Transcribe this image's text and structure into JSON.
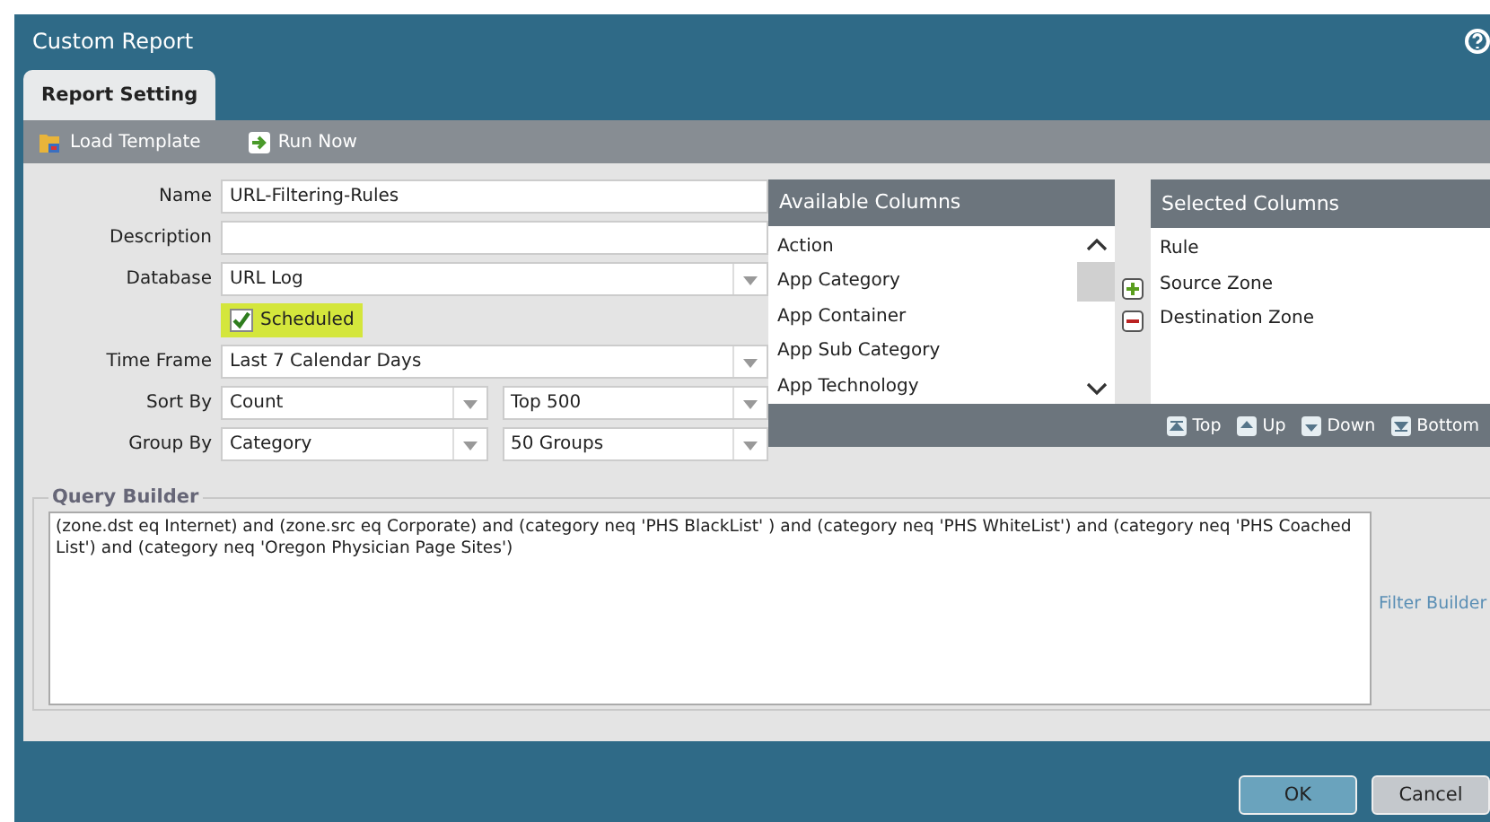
{
  "window": {
    "title": "Custom Report"
  },
  "tabs": [
    {
      "label": "Report Setting",
      "selected": true
    }
  ],
  "toolbar": [
    {
      "label": "Load Template",
      "kind": "folder"
    },
    {
      "label": "Run Now",
      "kind": "run"
    }
  ],
  "form": {
    "name": {
      "label": "Name",
      "value": "URL-Filtering-Rules"
    },
    "description": {
      "label": "Description"
    },
    "database": {
      "label": "Database",
      "value": "URL Log"
    },
    "scheduled": {
      "label": "Scheduled",
      "checked": true
    },
    "time_frame": {
      "label": "Time Frame",
      "value": "Last 7 Calendar Days"
    },
    "sort_by": {
      "label": "Sort By",
      "value": "Count",
      "limit": "Top 500"
    },
    "group_by": {
      "label": "Group By",
      "value": "Category",
      "limit": "50 Groups"
    }
  },
  "available_columns": {
    "title": "Available Columns",
    "items": [
      "Action",
      "App Category",
      "App Container",
      "App Sub Category",
      "App Technology"
    ]
  },
  "selected_columns": {
    "title": "Selected Columns",
    "items": [
      "Rule",
      "Source Zone",
      "Destination Zone"
    ]
  },
  "order_buttons": [
    {
      "label": "Top",
      "kind": "top"
    },
    {
      "label": "Up",
      "kind": "up"
    },
    {
      "label": "Down",
      "kind": "down"
    },
    {
      "label": "Bottom",
      "kind": "bottom"
    }
  ],
  "query_builder": {
    "title": "Query Builder",
    "value": "(zone.dst eq Internet) and (zone.src eq Corporate) and (category neq 'PHS BlackList' ) and (category neq 'PHS WhiteList') and (category neq 'PHS Coached List') and (category neq 'Oregon Physician Page Sites')",
    "link": "Filter Builder"
  },
  "buttons": [
    {
      "label": "OK",
      "kind": "primary"
    },
    {
      "label": "Cancel",
      "kind": "secondary"
    }
  ]
}
